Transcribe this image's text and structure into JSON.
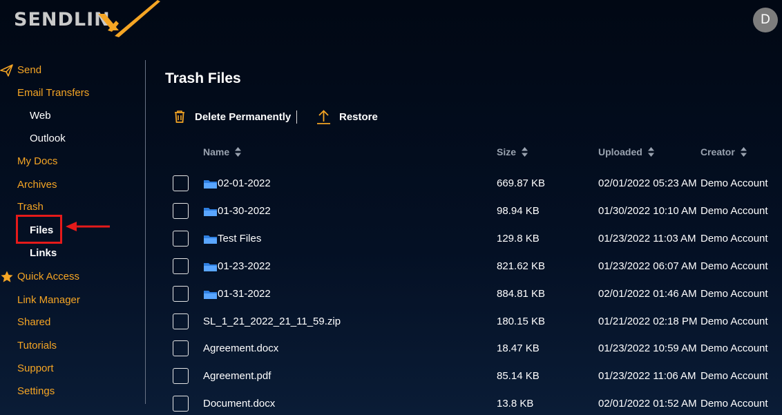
{
  "brand": {
    "logo_text": "SENDLIN",
    "logo_accent_color": "#f5a524"
  },
  "user": {
    "avatar_initial": "D"
  },
  "sidebar": {
    "items": [
      {
        "label": "Send",
        "icon": "paper-plane-icon"
      },
      {
        "label": "Email Transfers"
      },
      {
        "label": "Web"
      },
      {
        "label": "Outlook"
      },
      {
        "label": "My Docs"
      },
      {
        "label": "Archives"
      },
      {
        "label": "Trash"
      },
      {
        "label": "Files",
        "selected": true
      },
      {
        "label": "Links"
      },
      {
        "label": "Quick Access",
        "icon": "star-icon"
      },
      {
        "label": "Link Manager"
      },
      {
        "label": "Shared"
      },
      {
        "label": "Tutorials"
      },
      {
        "label": "Support"
      },
      {
        "label": "Settings"
      }
    ]
  },
  "main": {
    "title": "Trash Files",
    "toolbar": {
      "delete_label": "Delete Permanently",
      "restore_label": "Restore"
    },
    "table": {
      "columns": [
        "Name",
        "Size",
        "Uploaded",
        "Creator"
      ],
      "rows": [
        {
          "name": "02-01-2022",
          "type": "folder",
          "size": "669.87 KB",
          "uploaded": "02/01/2022 05:23 AM",
          "creator": "Demo Account"
        },
        {
          "name": "01-30-2022",
          "type": "folder",
          "size": "98.94 KB",
          "uploaded": "01/30/2022 10:10 AM",
          "creator": "Demo Account"
        },
        {
          "name": "Test Files",
          "type": "folder",
          "size": "129.8 KB",
          "uploaded": "01/23/2022 11:03 AM",
          "creator": "Demo Account"
        },
        {
          "name": "01-23-2022",
          "type": "folder",
          "size": "821.62 KB",
          "uploaded": "01/23/2022 06:07 AM",
          "creator": "Demo Account"
        },
        {
          "name": "01-31-2022",
          "type": "folder",
          "size": "884.81 KB",
          "uploaded": "02/01/2022 01:46 AM",
          "creator": "Demo Account"
        },
        {
          "name": "SL_1_21_2022_21_11_59.zip",
          "type": "file",
          "size": "180.15 KB",
          "uploaded": "01/21/2022 02:18 PM",
          "creator": "Demo Account"
        },
        {
          "name": "Agreement.docx",
          "type": "file",
          "size": "18.47 KB",
          "uploaded": "01/23/2022 10:59 AM",
          "creator": "Demo Account"
        },
        {
          "name": "Agreement.pdf",
          "type": "file",
          "size": "85.14 KB",
          "uploaded": "01/23/2022 11:06 AM",
          "creator": "Demo Account"
        },
        {
          "name": "Document.docx",
          "type": "file",
          "size": "13.8 KB",
          "uploaded": "02/01/2022 01:52 AM",
          "creator": "Demo Account"
        }
      ]
    }
  },
  "colors": {
    "accent": "#f5a524",
    "highlight_border": "#e51a1a",
    "folder": "#3b8ff0"
  }
}
